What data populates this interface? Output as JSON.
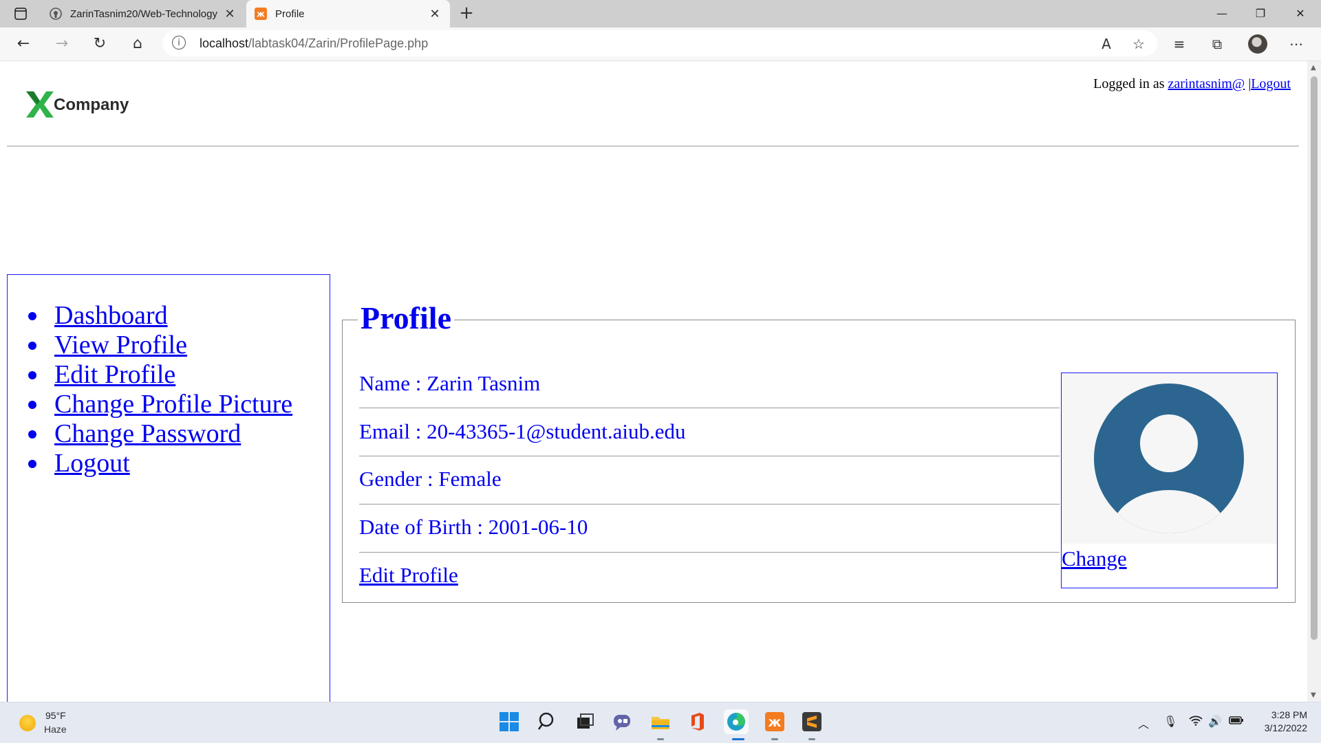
{
  "browser": {
    "tabs": [
      {
        "title": "ZarinTasnim20/Web-Technology",
        "icon": "github-icon",
        "active": false
      },
      {
        "title": "Profile",
        "icon": "xampp-icon",
        "active": true
      }
    ],
    "url_host": "localhost",
    "url_path": "/labtask04/Zarin/ProfilePage.php"
  },
  "header": {
    "logo_text": "Company",
    "logged_in_prefix": "Logged in as ",
    "username": "zarintasnim@",
    "separator": " |",
    "logout_label": "Logout"
  },
  "sidebar": {
    "items": [
      {
        "label": "Dashboard"
      },
      {
        "label": "View Profile"
      },
      {
        "label": "Edit Profile"
      },
      {
        "label": "Change Profile Picture"
      },
      {
        "label": "Change Password"
      },
      {
        "label": "Logout"
      }
    ]
  },
  "profile": {
    "legend": "Profile",
    "name": "Name : Zarin Tasnim",
    "email": "Email : 20-43365-1@student.aiub.edu",
    "gender": "Gender : Female",
    "dob": "Date of Birth : 2001-06-10",
    "edit_link": "Edit Profile",
    "change_link": "Change"
  },
  "taskbar": {
    "temperature": "95°F",
    "condition": "Haze",
    "time": "3:28 PM",
    "date": "3/12/2022"
  },
  "colors": {
    "link": "#0000ee",
    "avatar": "#2c6690"
  }
}
